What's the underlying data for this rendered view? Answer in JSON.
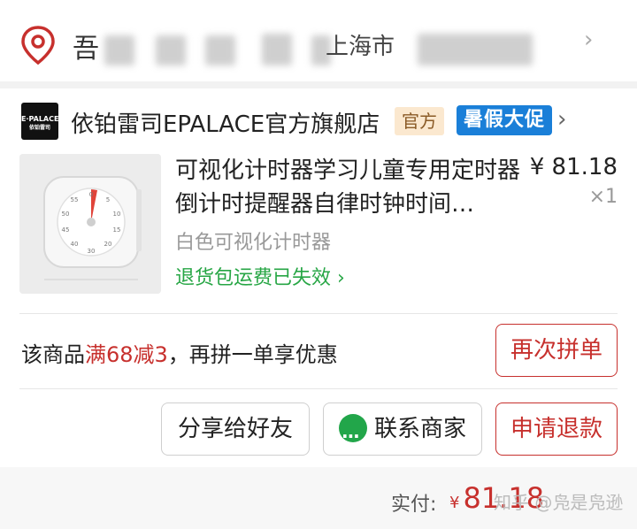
{
  "address": {
    "line_start": "吾",
    "city": "上海市",
    "chevron": "›"
  },
  "store": {
    "logo_text_1": "E·PALACE",
    "logo_text_2": "依铂雷司",
    "name": "依铂雷司EPALACE官方旗舰店",
    "badge_official": "官方",
    "badge_promo": "暑假大促",
    "chevron": "›"
  },
  "product": {
    "title": "可视化计时器学习儿童专用定时器倒计时提醒器自律时钟时间…",
    "price": "¥ 81.18",
    "qty": "×1",
    "variant": "白色可视化计时器",
    "return_note": "退货包运费已失效",
    "return_chevron": "›"
  },
  "promo": {
    "prefix": "该商品",
    "highlight": "满68减3",
    "suffix": "，再拼一单享优惠",
    "button": "再次拼单"
  },
  "actions": {
    "share": "分享给好友",
    "contact": "联系商家",
    "refund": "申请退款"
  },
  "total": {
    "label": "实付:",
    "currency": "¥",
    "amount": "81.18",
    "watermark": "知乎 @凫是凫逊"
  },
  "colors": {
    "accent_red": "#c7302d",
    "green": "#27a645",
    "promo_blue": "#1a7fd8"
  }
}
